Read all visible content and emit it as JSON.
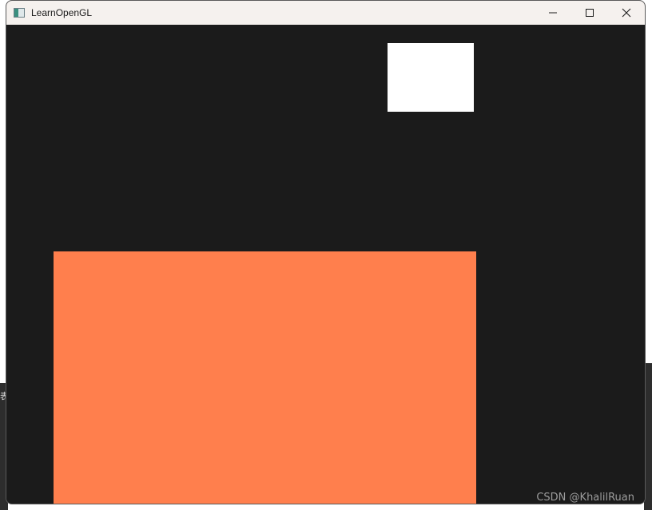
{
  "window": {
    "title": "LearnOpenGL",
    "controls": {
      "minimize": "minimize-icon",
      "maximize": "maximize-icon",
      "close": "close-icon"
    }
  },
  "scene": {
    "background_color": "#1b1b1b",
    "light_cube_color": "#ffffff",
    "object_color": "#ff7f4d"
  },
  "watermark": "CSDN @KhalilRuan",
  "desktop_fragment": "表"
}
